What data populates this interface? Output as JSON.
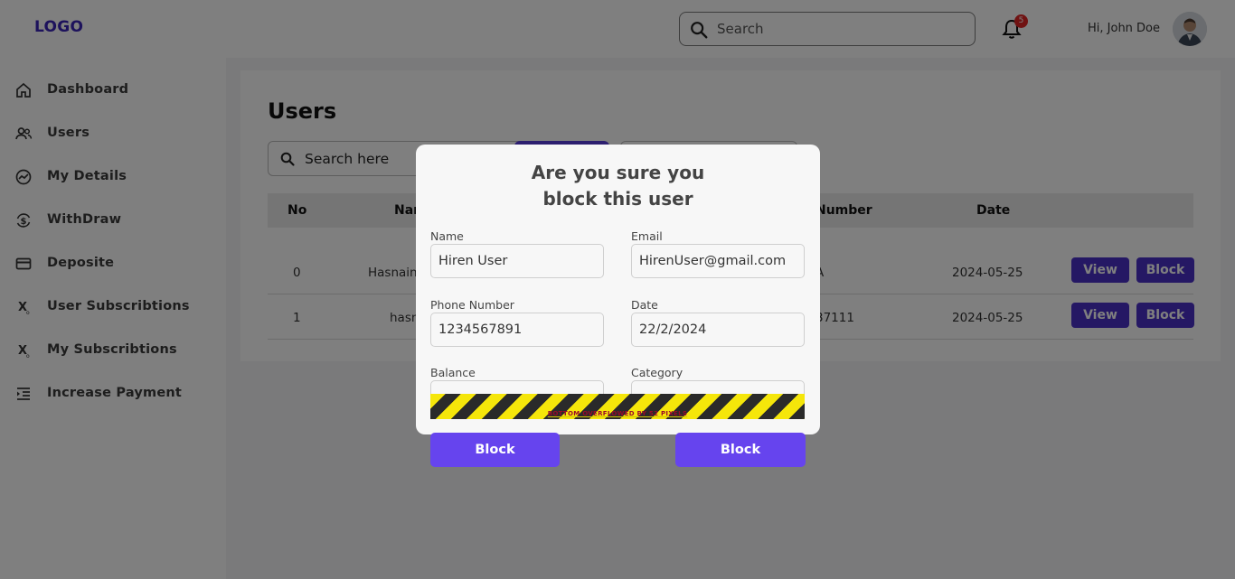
{
  "header": {
    "logo": "LOGO",
    "search_placeholder": "Search",
    "notification_count": "5",
    "greeting": "Hi, John Doe"
  },
  "sidebar": {
    "items": [
      {
        "label": "Dashboard",
        "icon": "home-icon"
      },
      {
        "label": "Users",
        "icon": "users-icon"
      },
      {
        "label": "My Details",
        "icon": "chart-circle-icon"
      },
      {
        "label": "WithDraw",
        "icon": "dollar-refresh-icon"
      },
      {
        "label": "Deposite",
        "icon": "credit-card-icon"
      },
      {
        "label": "User Subscribtions",
        "icon": "subscript-x-icon"
      },
      {
        "label": "My Subscribtions",
        "icon": "subscript-x-icon"
      },
      {
        "label": "Increase Payment",
        "icon": "indent-list-icon"
      }
    ]
  },
  "main": {
    "title": "Users",
    "search_placeholder": "Search here",
    "table": {
      "headers": {
        "no": "No",
        "name": "Nar",
        "number": "Number",
        "date": "Date"
      },
      "rows": [
        {
          "no": "0",
          "name": "Hasnain",
          "number": "A",
          "date": "2024-05-25",
          "view": "View",
          "block": "Block"
        },
        {
          "no": "1",
          "name": "hasn",
          "number": "37111",
          "date": "2024-05-25",
          "view": "View",
          "block": "Block"
        }
      ]
    }
  },
  "dialog": {
    "title_line1": "Are you sure you",
    "title_line2": "block this user",
    "fields": {
      "name_label": "Name",
      "name_value": "Hiren User",
      "email_label": "Email",
      "email_value": "HirenUser@gmail.com",
      "phone_label": "Phone Number",
      "phone_value": "1234567891",
      "date_label": "Date",
      "date_value": "22/2/2024",
      "balance_label": "Balance",
      "category_label": "Category"
    },
    "overflow_warning": "BOTTOM OVERFLOWED BY 52 PIXELS",
    "button_left": "Block",
    "button_right": "Block"
  },
  "colors": {
    "accent": "#5b3ee0",
    "logo": "#3b24b8",
    "badge": "#e02424",
    "overflow_yellow": "#f5e60a",
    "overflow_dark": "#2a2a2a"
  }
}
